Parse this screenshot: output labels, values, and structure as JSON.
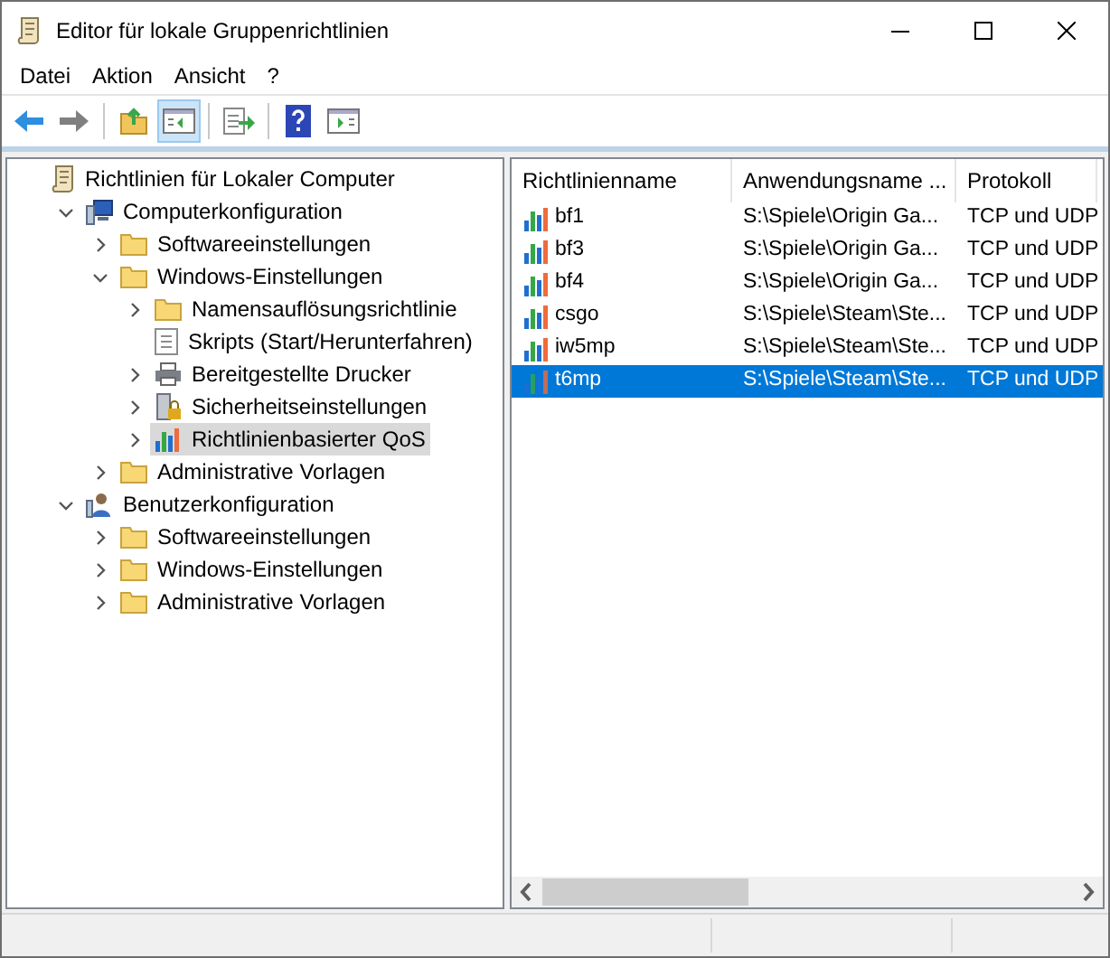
{
  "window": {
    "title": "Editor für lokale Gruppenrichtlinien"
  },
  "menu": [
    "Datei",
    "Aktion",
    "Ansicht",
    "?"
  ],
  "toolbar": [
    {
      "kind": "back"
    },
    {
      "kind": "forward"
    },
    {
      "kind": "sep"
    },
    {
      "kind": "up"
    },
    {
      "kind": "tree",
      "selected": true
    },
    {
      "kind": "sep"
    },
    {
      "kind": "export"
    },
    {
      "kind": "sep"
    },
    {
      "kind": "help"
    },
    {
      "kind": "pane"
    }
  ],
  "tree": [
    {
      "label": "Richtlinien für Lokaler Computer",
      "kind": "scroll",
      "selected": false,
      "children": [
        {
          "label": "Computerkonfiguration",
          "kind": "computer",
          "expanded": true,
          "selected": false,
          "children": [
            {
              "label": "Softwareeinstellungen",
              "kind": "folder",
              "expanded": false,
              "selected": false
            },
            {
              "label": "Windows-Einstellungen",
              "kind": "folder",
              "expanded": true,
              "selected": false,
              "children": [
                {
                  "label": "Namensauflösungsrichtlinie",
                  "kind": "folder",
                  "expanded": false,
                  "selected": false
                },
                {
                  "label": "Skripts (Start/Herunterfahren)",
                  "kind": "script",
                  "selected": false
                },
                {
                  "label": "Bereitgestellte Drucker",
                  "kind": "printer",
                  "expanded": false,
                  "selected": false
                },
                {
                  "label": "Sicherheitseinstellungen",
                  "kind": "security",
                  "expanded": false,
                  "selected": false
                },
                {
                  "label": "Richtlinienbasierter QoS",
                  "kind": "qos",
                  "expanded": false,
                  "selected": true
                }
              ]
            },
            {
              "label": "Administrative Vorlagen",
              "kind": "folder",
              "expanded": false,
              "selected": false
            }
          ]
        },
        {
          "label": "Benutzerkonfiguration",
          "kind": "user",
          "expanded": true,
          "selected": false,
          "children": [
            {
              "label": "Softwareeinstellungen",
              "kind": "folder",
              "expanded": false,
              "selected": false
            },
            {
              "label": "Windows-Einstellungen",
              "kind": "folder",
              "expanded": false,
              "selected": false
            },
            {
              "label": "Administrative Vorlagen",
              "kind": "folder",
              "expanded": false,
              "selected": false
            }
          ]
        }
      ]
    }
  ],
  "table": {
    "columns": [
      "Richtlinienname",
      "Anwendungsname ...",
      "Protokoll"
    ],
    "rows": [
      {
        "cells": [
          "bf1",
          "S:\\Spiele\\Origin Ga...",
          "TCP und UDP"
        ],
        "selected": false
      },
      {
        "cells": [
          "bf3",
          "S:\\Spiele\\Origin Ga...",
          "TCP und UDP"
        ],
        "selected": false
      },
      {
        "cells": [
          "bf4",
          "S:\\Spiele\\Origin Ga...",
          "TCP und UDP"
        ],
        "selected": false
      },
      {
        "cells": [
          "csgo",
          "S:\\Spiele\\Steam\\Ste...",
          "TCP und UDP"
        ],
        "selected": false
      },
      {
        "cells": [
          "iw5mp",
          "S:\\Spiele\\Steam\\Ste...",
          "TCP und UDP"
        ],
        "selected": false
      },
      {
        "cells": [
          "t6mp",
          "S:\\Spiele\\Steam\\Ste...",
          "TCP und UDP"
        ],
        "selected": true
      }
    ]
  }
}
